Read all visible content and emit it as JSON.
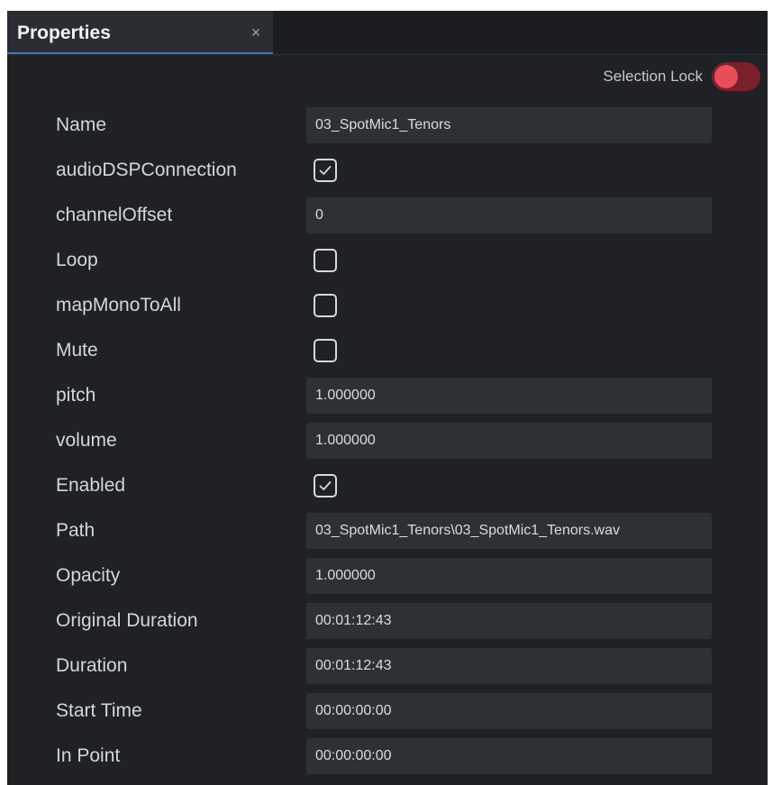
{
  "tab": {
    "title": "Properties",
    "close_glyph": "×"
  },
  "selection_lock": {
    "label": "Selection Lock",
    "on": false,
    "accent_color": "#e84d5a"
  },
  "properties": [
    {
      "label": "Name",
      "type": "text",
      "value": "03_SpotMic1_Tenors"
    },
    {
      "label": "audioDSPConnection",
      "type": "checkbox",
      "checked": true
    },
    {
      "label": "channelOffset",
      "type": "text",
      "value": "0"
    },
    {
      "label": "Loop",
      "type": "checkbox",
      "checked": false
    },
    {
      "label": "mapMonoToAll",
      "type": "checkbox",
      "checked": false
    },
    {
      "label": "Mute",
      "type": "checkbox",
      "checked": false
    },
    {
      "label": "pitch",
      "type": "text",
      "value": "1.000000"
    },
    {
      "label": "volume",
      "type": "text",
      "value": "1.000000"
    },
    {
      "label": "Enabled",
      "type": "checkbox",
      "checked": true
    },
    {
      "label": "Path",
      "type": "text",
      "value": "03_SpotMic1_Tenors\\03_SpotMic1_Tenors.wav"
    },
    {
      "label": "Opacity",
      "type": "text",
      "value": "1.000000"
    },
    {
      "label": "Original Duration",
      "type": "text",
      "value": "00:01:12:43"
    },
    {
      "label": "Duration",
      "type": "text",
      "value": "00:01:12:43"
    },
    {
      "label": "Start Time",
      "type": "text",
      "value": "00:00:00:00"
    },
    {
      "label": "In Point",
      "type": "text",
      "value": "00:00:00:00"
    }
  ]
}
